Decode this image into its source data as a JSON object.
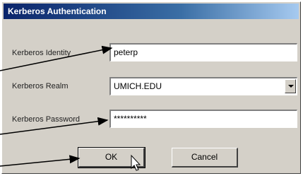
{
  "window": {
    "title": "Kerberos Authentication"
  },
  "form": {
    "identity_label": "Kerberos Identity",
    "identity_value": "peterp",
    "realm_label": "Kerberos Realm",
    "realm_value": "UMICH.EDU",
    "password_label": "Kerberos Password",
    "password_value": "**********"
  },
  "buttons": {
    "ok_label": "OK",
    "cancel_label": "Cancel"
  }
}
